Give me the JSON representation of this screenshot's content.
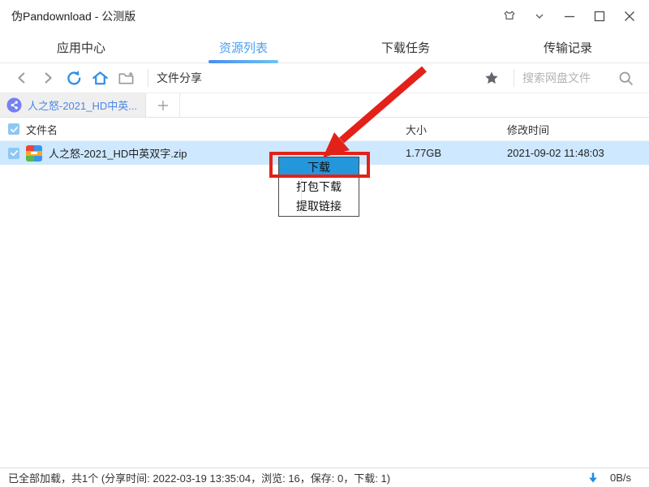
{
  "titlebar": {
    "title": "伪Pandownload - 公测版"
  },
  "tabs": [
    {
      "label": "应用中心",
      "active": false
    },
    {
      "label": "资源列表",
      "active": true
    },
    {
      "label": "下载任务",
      "active": false
    },
    {
      "label": "传输记录",
      "active": false
    }
  ],
  "toolbar": {
    "path_label": "文件分享",
    "search_placeholder": "搜索网盘文件"
  },
  "doc_tab": {
    "label": "人之怒-2021_HD中英..."
  },
  "table": {
    "headers": {
      "name": "文件名",
      "size": "大小",
      "modified": "修改时间"
    },
    "rows": [
      {
        "name": "人之怒-2021_HD中英双字.zip",
        "size": "1.77GB",
        "modified": "2021-09-02 11:48:03",
        "selected": true
      }
    ]
  },
  "context_menu": {
    "items": [
      "下载",
      "打包下载",
      "提取链接"
    ],
    "highlighted_index": 0
  },
  "statusbar": {
    "summary": "已全部加载，共1个 (分享时间: 2022-03-19 13:35:04，浏览: 16，保存: 0，下载: 1)",
    "speed": "0B/s"
  },
  "colors": {
    "accent_blue": "#4aa0f5",
    "tab_underline": "#4a8df0",
    "selection_row": "#cde8ff",
    "menu_highlight": "#2496dc",
    "annotation_red": "#e32119",
    "doc_tab_icon": "#7580f2"
  }
}
